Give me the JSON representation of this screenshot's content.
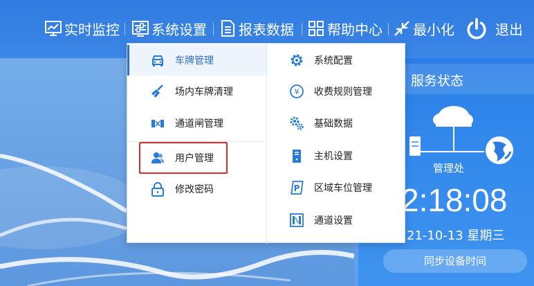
{
  "nav": {
    "realtime": "实时监控",
    "settings": "系统设置",
    "reports": "报表数据",
    "help": "帮助中心",
    "minimize": "最小化",
    "exit": "退出"
  },
  "menu": {
    "left": [
      {
        "label": "车牌管理",
        "icon": "car-icon"
      },
      {
        "label": "场内车牌清理",
        "icon": "broom-icon"
      },
      {
        "label": "通道闸管理",
        "icon": "barrier-icon"
      },
      {
        "label": "用户管理",
        "icon": "users-icon"
      },
      {
        "label": "修改密码",
        "icon": "lock-icon"
      }
    ],
    "right": [
      {
        "label": "系统配置",
        "icon": "gear-icon"
      },
      {
        "label": "收费规则管理",
        "icon": "yen-icon"
      },
      {
        "label": "基础数据",
        "icon": "cogs-icon"
      },
      {
        "label": "主机设置",
        "icon": "server-icon"
      },
      {
        "label": "区域车位管理",
        "icon": "parking-icon"
      },
      {
        "label": "通道设置",
        "icon": "channel-icon"
      }
    ]
  },
  "status": {
    "title": "服务状态",
    "node_label": "管理处",
    "clock": "2:18:08",
    "date": "21-10-13 星期三",
    "sync_button": "同步设备时间"
  },
  "colors": {
    "topbar": "#2f7be0",
    "accent": "#2a6fc9",
    "highlight": "#e02a2a",
    "icon_blue": "#2a7ad8"
  }
}
